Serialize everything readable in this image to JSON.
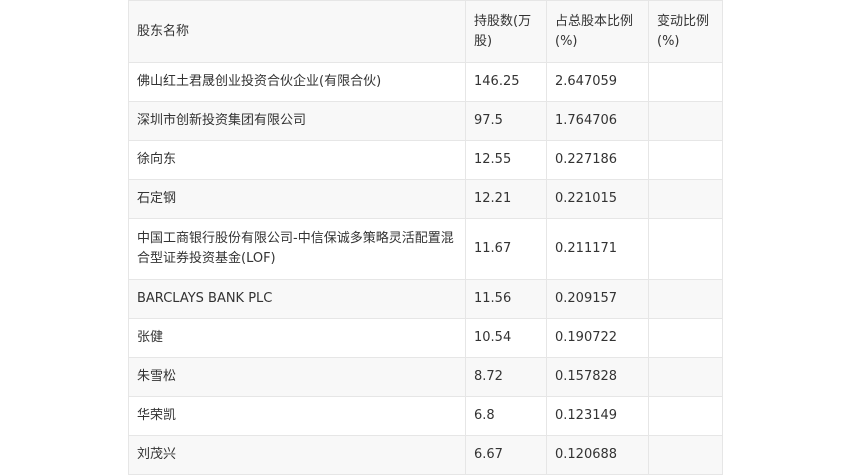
{
  "table": {
    "headers": [
      "股东名称",
      "持股数(万股)",
      "占总股本比例(%)",
      "变动比例(%)"
    ],
    "rows": [
      [
        "佛山红土君晟创业投资合伙企业(有限合伙)",
        "146.25",
        "2.647059",
        ""
      ],
      [
        "深圳市创新投资集团有限公司",
        "97.5",
        "1.764706",
        ""
      ],
      [
        "徐向东",
        "12.55",
        "0.227186",
        ""
      ],
      [
        "石定钢",
        "12.21",
        "0.221015",
        ""
      ],
      [
        "中国工商银行股份有限公司-中信保诚多策略灵活配置混合型证券投资基金(LOF)",
        "11.67",
        "0.211171",
        ""
      ],
      [
        "BARCLAYS BANK PLC",
        "11.56",
        "0.209157",
        ""
      ],
      [
        "张健",
        "10.54",
        "0.190722",
        ""
      ],
      [
        "朱雪松",
        "8.72",
        "0.157828",
        ""
      ],
      [
        "华荣凯",
        "6.8",
        "0.123149",
        ""
      ],
      [
        "刘茂兴",
        "6.67",
        "0.120688",
        ""
      ]
    ]
  }
}
